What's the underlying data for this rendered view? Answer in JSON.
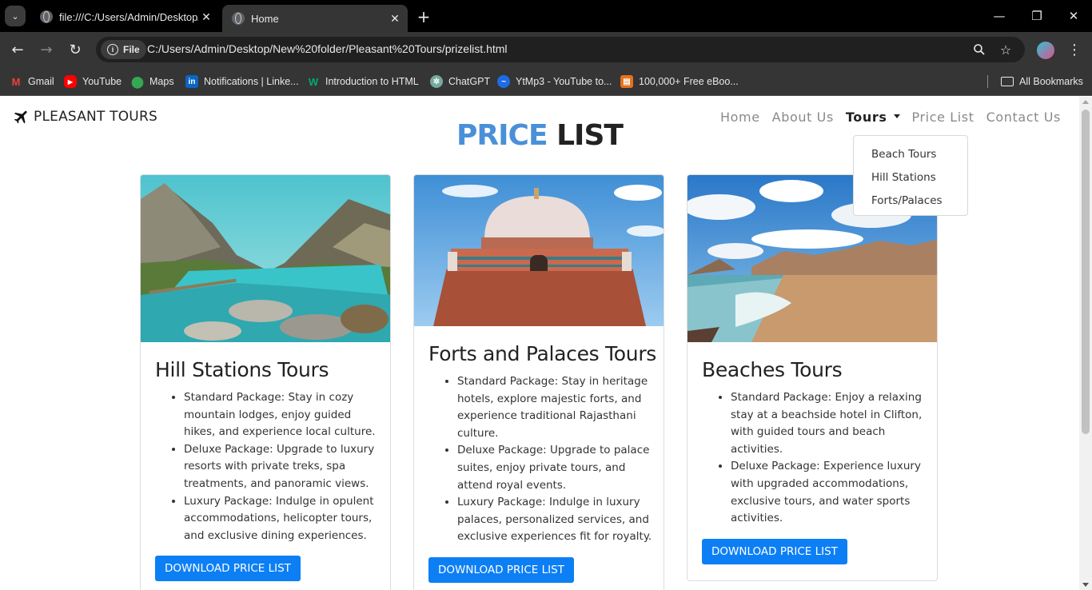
{
  "browser": {
    "tabs": [
      {
        "title": "file:///C:/Users/Admin/Desktop/"
      },
      {
        "title": "Home"
      }
    ],
    "address": {
      "chip": "File",
      "url": "C:/Users/Admin/Desktop/New%20folder/Pleasant%20Tours/prizelist.html"
    },
    "bookmarks": [
      {
        "label": "Gmail",
        "icon": "gmail-icon",
        "color": "#ea4335"
      },
      {
        "label": "YouTube",
        "icon": "youtube-icon",
        "color": "#ff0000"
      },
      {
        "label": "Maps",
        "icon": "maps-icon",
        "color": "#34a853"
      },
      {
        "label": "Notifications | Linke...",
        "icon": "linkedin-icon",
        "color": "#0a66c2"
      },
      {
        "label": "Introduction to HTML",
        "icon": "w3schools-icon",
        "color": "#04aa6d"
      },
      {
        "label": "ChatGPT",
        "icon": "chatgpt-icon",
        "color": "#74aa9c"
      },
      {
        "label": "YtMp3 - YouTube to...",
        "icon": "ytmp3-icon",
        "color": "#1e6be6"
      },
      {
        "label": "100,000+ Free eBoo...",
        "icon": "ebook-icon",
        "color": "#e8711a"
      }
    ],
    "all_bookmarks": "All Bookmarks"
  },
  "site": {
    "brand": "PLEASANT TOURS",
    "nav": [
      "Home",
      "About Us",
      "Tours",
      "Price List",
      "Contact Us"
    ],
    "dropdown": [
      "Beach Tours",
      "Hill Stations",
      "Forts/Palaces"
    ],
    "title_part1": "PRICE",
    "title_part2": "LIST"
  },
  "cards": [
    {
      "title": "Hill Stations Tours",
      "items": [
        "Standard Package: Stay in cozy mountain lodges, enjoy guided hikes, and experience local culture.",
        "Deluxe Package: Upgrade to luxury resorts with private treks, spa treatments, and panoramic views.",
        "Luxury Package: Indulge in opulent accommodations, helicopter tours, and exclusive dining experiences."
      ],
      "button": "DOWNLOAD PRICE LIST"
    },
    {
      "title": "Forts and Palaces Tours",
      "items": [
        "Standard Package: Stay in heritage hotels, explore majestic forts, and experience traditional Rajasthani culture.",
        "Deluxe Package: Upgrade to palace suites, enjoy private tours, and attend royal events.",
        "Luxury Package: Indulge in luxury palaces, personalized services, and exclusive experiences fit for royalty."
      ],
      "button": "DOWNLOAD PRICE LIST"
    },
    {
      "title": "Beaches Tours",
      "items": [
        "Standard Package: Enjoy a relaxing stay at a beachside hotel in Clifton, with guided tours and beach activities.",
        "Deluxe Package: Experience luxury with upgraded accommodations, exclusive tours, and water sports activities."
      ],
      "button": "DOWNLOAD PRICE LIST"
    }
  ],
  "colors": {
    "accent": "#0d7ff5",
    "title_blue": "#4a90d9"
  }
}
